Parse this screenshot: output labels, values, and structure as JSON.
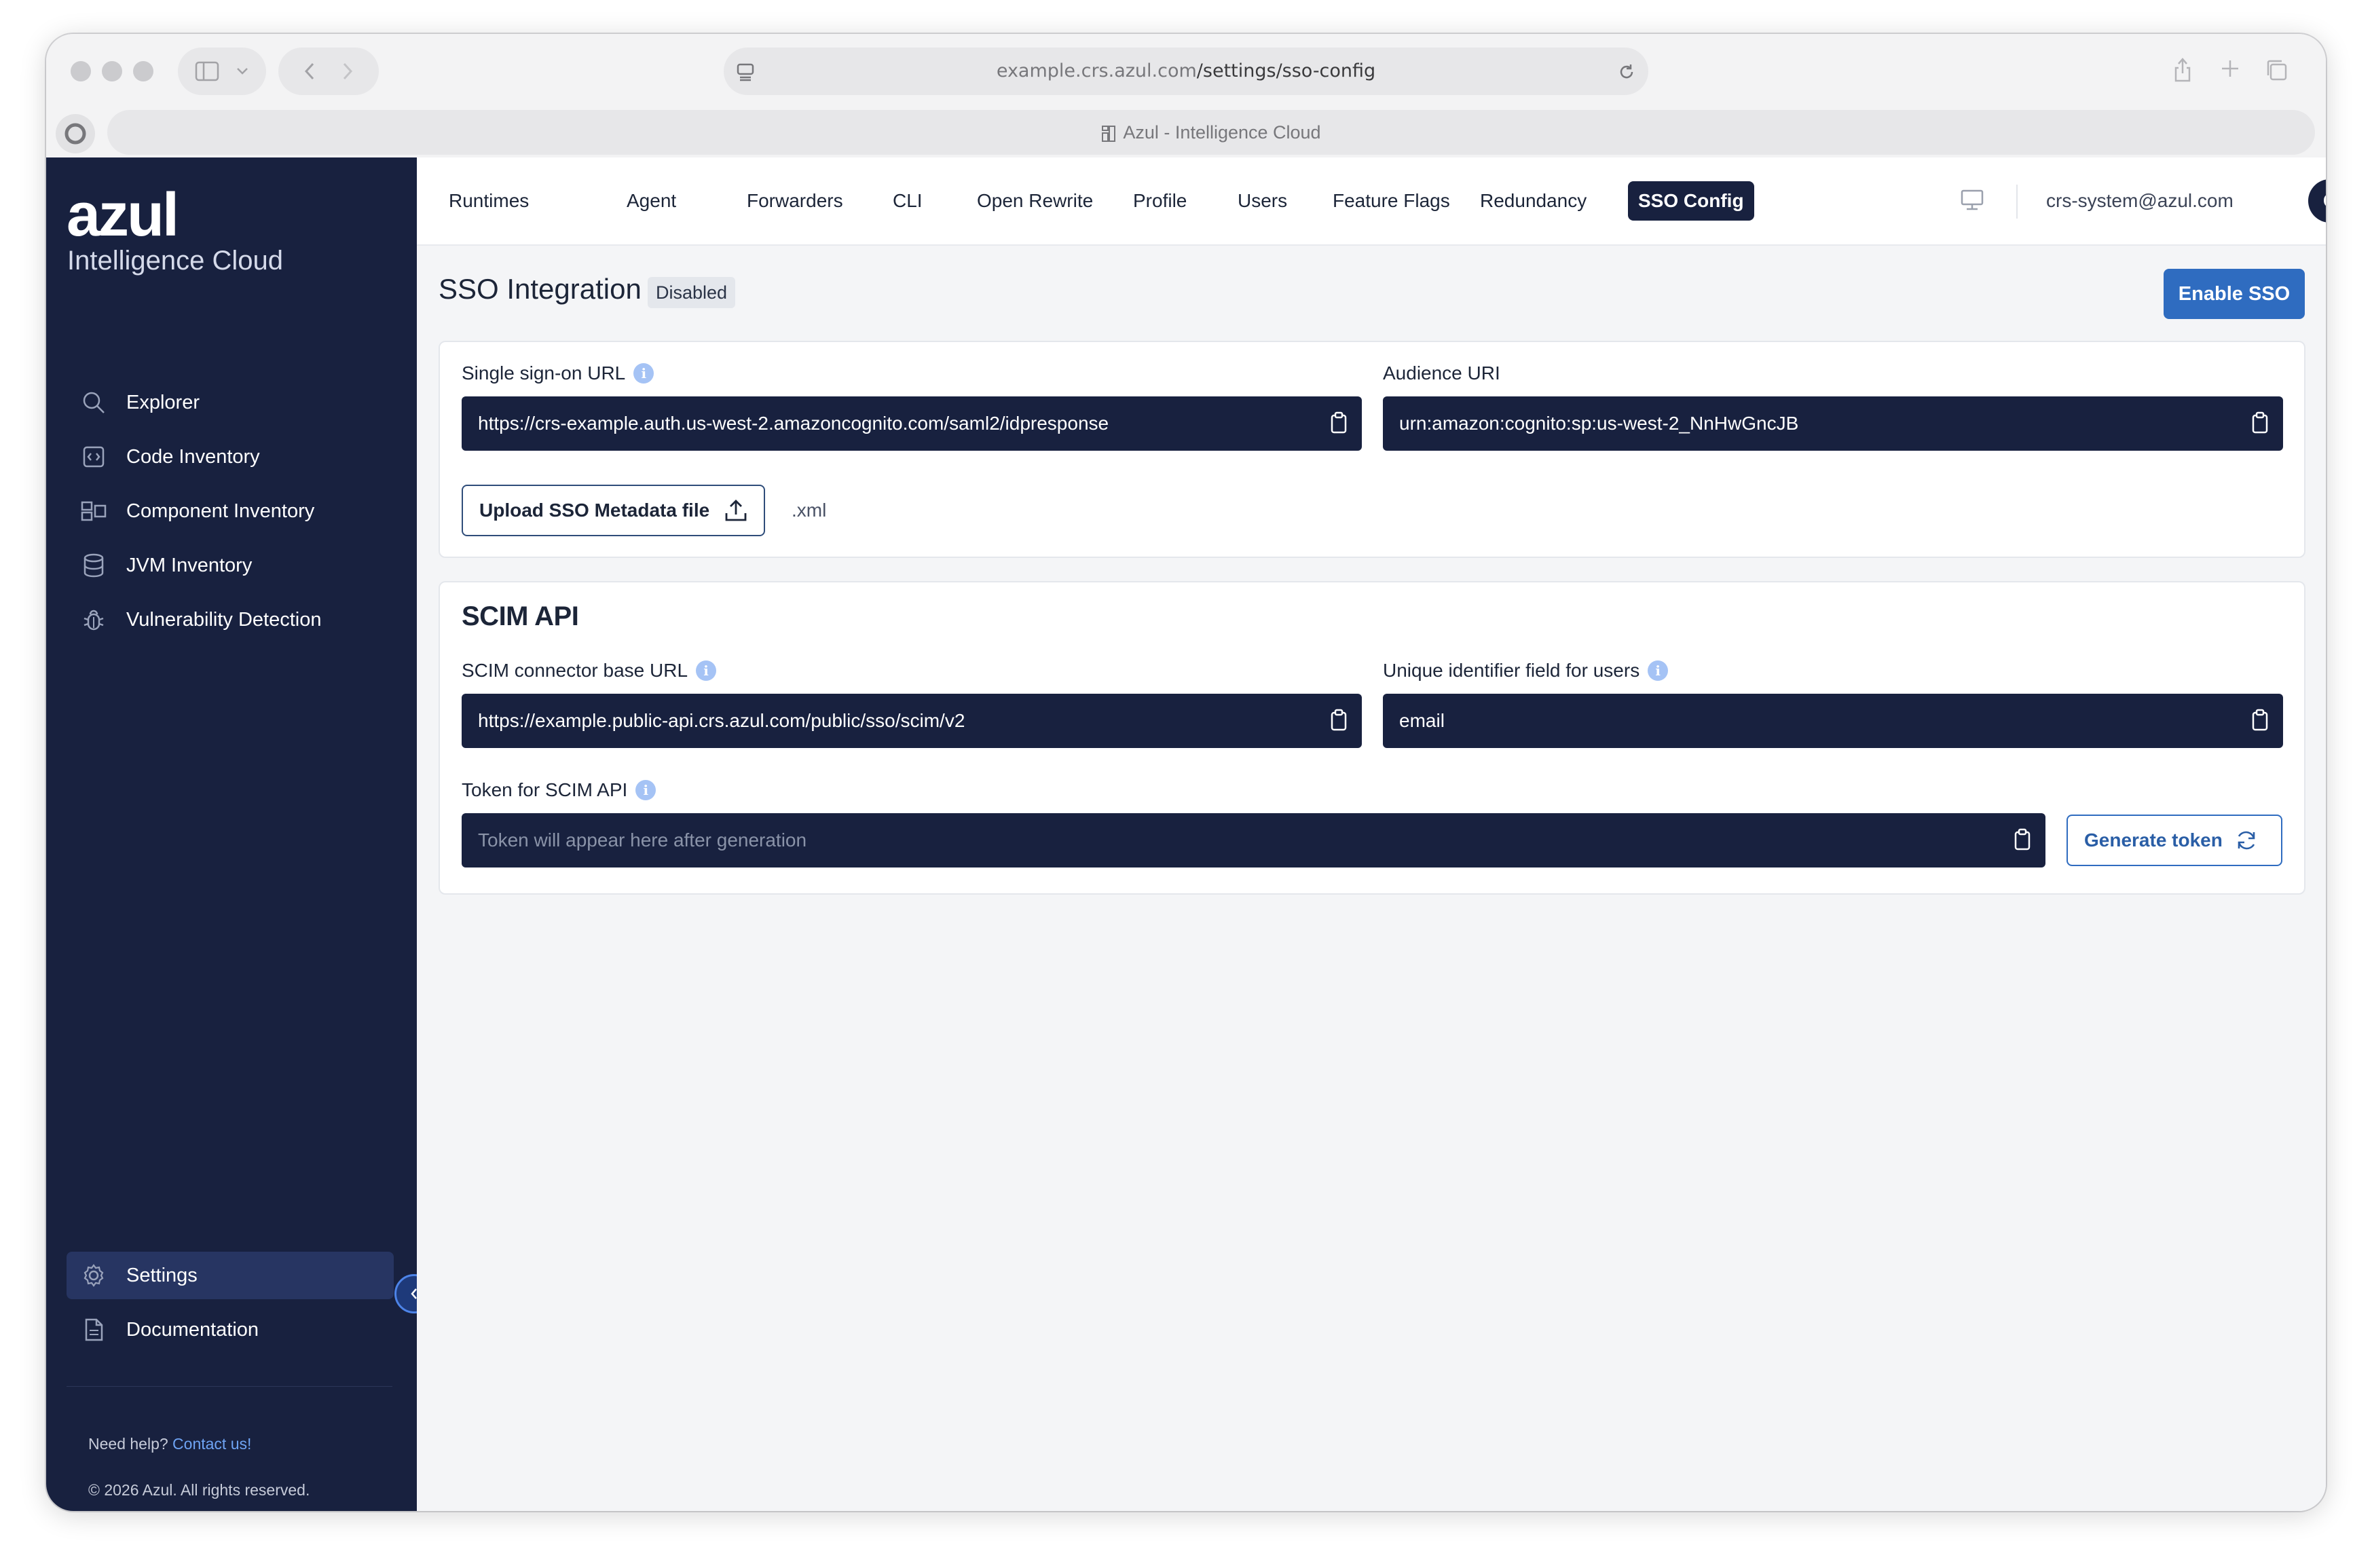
{
  "browser": {
    "url_domain": "example.crs.azul.com",
    "url_path": "/settings/sso-config",
    "tab_title": "Azul - Intelligence Cloud"
  },
  "sidebar": {
    "logo": "azul",
    "logo_sub": "Intelligence Cloud",
    "items": [
      {
        "label": "Explorer",
        "icon": "search-icon"
      },
      {
        "label": "Code Inventory",
        "icon": "code-icon"
      },
      {
        "label": "Component Inventory",
        "icon": "components-icon"
      },
      {
        "label": "JVM Inventory",
        "icon": "database-icon"
      },
      {
        "label": "Vulnerability Detection",
        "icon": "bug-icon"
      }
    ],
    "bottom_items": [
      {
        "label": "Settings",
        "icon": "gear-icon",
        "active": true
      },
      {
        "label": "Documentation",
        "icon": "document-icon"
      }
    ],
    "help_text": "Need help?",
    "help_link": "Contact us!",
    "copyright": "© 2026 Azul. All rights reserved."
  },
  "topnav": {
    "tabs": [
      {
        "label": "Runtimes"
      },
      {
        "label": "Agent"
      },
      {
        "label": "Forwarders"
      },
      {
        "label": "CLI"
      },
      {
        "label": "Open Rewrite"
      },
      {
        "label": "Profile"
      },
      {
        "label": "Users"
      },
      {
        "label": "Feature Flags"
      },
      {
        "label": "Redundancy"
      },
      {
        "label": "SSO Config",
        "active": true
      }
    ],
    "user_email": "crs-system@azul.com",
    "avatar_initial": "C"
  },
  "sso": {
    "title": "SSO Integration",
    "status": "Disabled",
    "enable_button": "Enable SSO",
    "sso_url_label": "Single sign-on URL",
    "sso_url_value": "https://crs-example.auth.us-west-2.amazoncognito.com/saml2/idpresponse",
    "audience_label": "Audience URI",
    "audience_value": "urn:amazon:cognito:sp:us-west-2_NnHwGncJB",
    "upload_button": "Upload SSO Metadata file",
    "upload_hint": ".xml"
  },
  "scim": {
    "title": "SCIM API",
    "base_url_label": "SCIM connector base URL",
    "base_url_value": "https://example.public-api.crs.azul.com/public/sso/scim/v2",
    "uid_label": "Unique identifier field for users",
    "uid_value": "email",
    "token_label": "Token for SCIM API",
    "token_placeholder": "Token will appear here after generation",
    "generate_button": "Generate token"
  },
  "colors": {
    "sidebar_bg": "#18213f",
    "accent": "#2f6cc0",
    "field_bg": "#18213f"
  }
}
